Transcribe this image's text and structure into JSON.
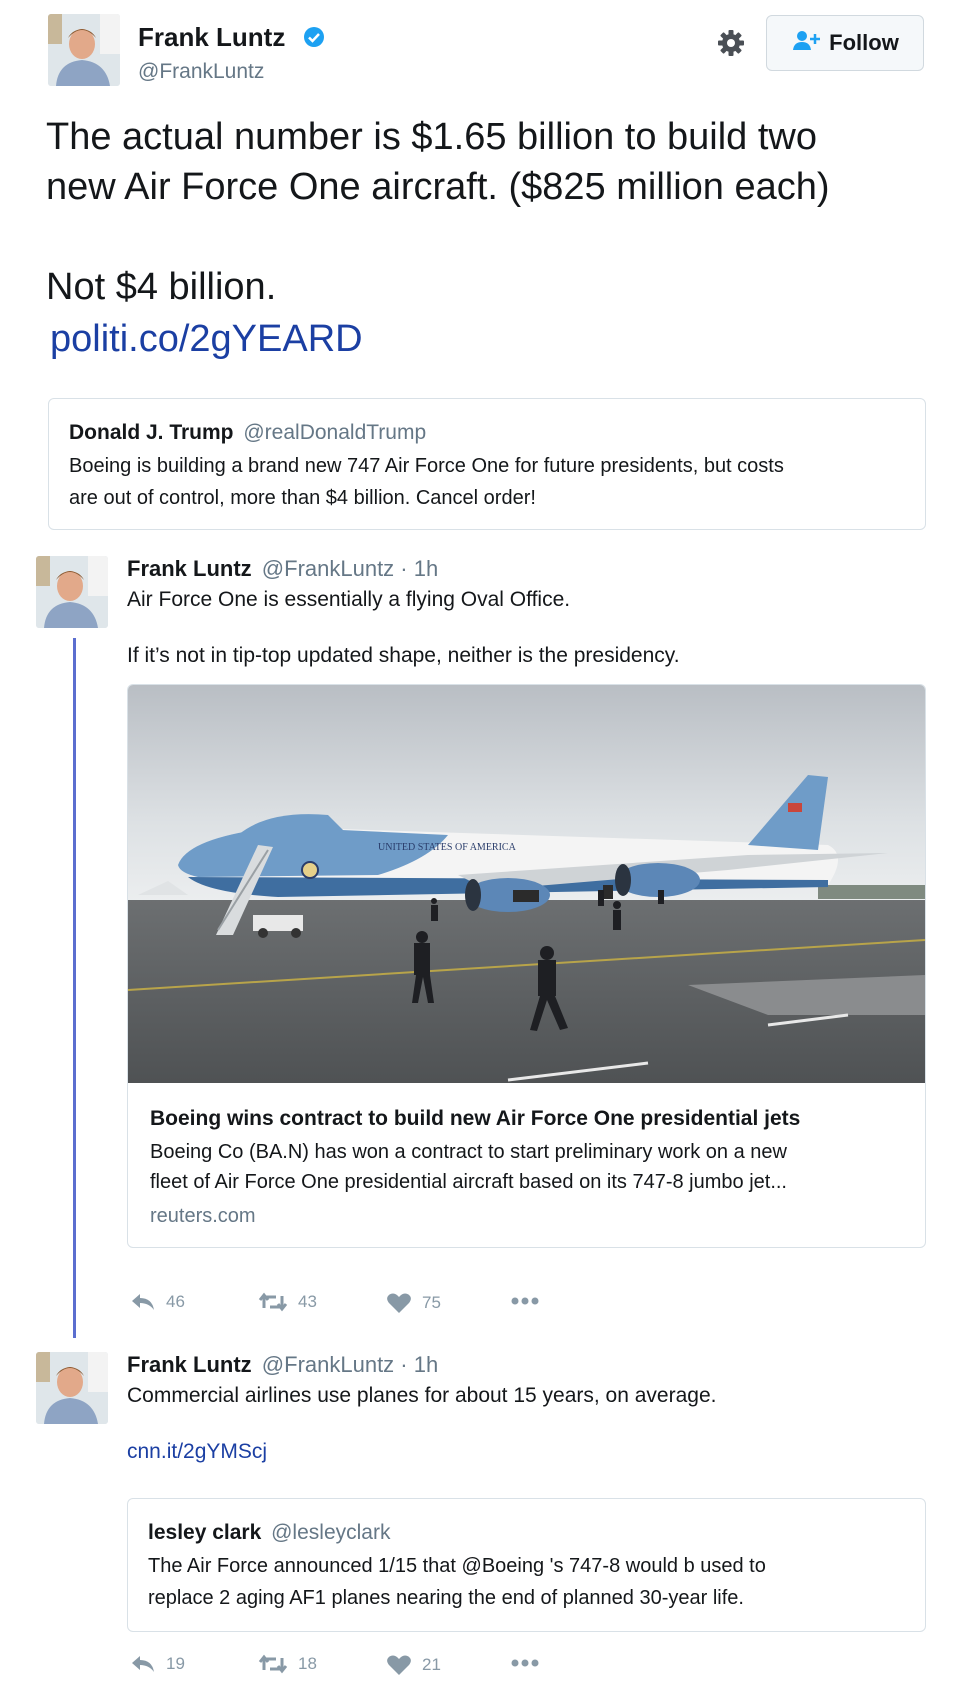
{
  "main_tweet": {
    "name": "Frank Luntz",
    "handle": "@FrankLuntz",
    "follow_label": "Follow",
    "text_line1": "The actual number is $1.65 billion to build two",
    "text_line2": "new Air Force One aircraft. ($825 million each)",
    "text_line3": "Not $4 billion.",
    "link": "politi.co/2gYEARD",
    "quoted": {
      "name": "Donald J. Trump",
      "handle": "@realDonaldTrump",
      "line1": "Boeing is building a brand new 747 Air Force One for future presidents, but costs",
      "line2": "are out of control, more than $4 billion. Cancel order!"
    }
  },
  "reply1": {
    "name": "Frank Luntz",
    "meta": "@FrankLuntz · 1h",
    "text1": "Air Force One is essentially a flying Oval Office.",
    "text2": "If it’s not in tip-top updated shape, neither is the presidency.",
    "card": {
      "image_text": "UNITED STATES OF AMERICA",
      "title": "Boeing wins contract to build new Air Force One presidential jets",
      "desc1": "Boeing Co (BA.N) has won a contract to start preliminary work on a new",
      "desc2": "fleet of Air Force One presidential aircraft based on its 747-8 jumbo jet...",
      "domain": "reuters.com"
    },
    "actions": {
      "replies": "46",
      "retweets": "43",
      "likes": "75"
    }
  },
  "reply2": {
    "name": "Frank Luntz",
    "meta": "@FrankLuntz · 1h",
    "text1": "Commercial airlines use planes for about 15 years, on average.",
    "link": "cnn.it/2gYMScj",
    "quoted": {
      "name": "lesley clark",
      "handle": "@lesleyclark",
      "line1": "The Air Force announced 1/15 that @Boeing 's 747-8 would b used to",
      "line2": "replace 2 aging AF1 planes nearing the end of planned 30-year life."
    },
    "actions": {
      "replies": "19",
      "retweets": "18",
      "likes": "21"
    }
  },
  "icons": [
    "verified-badge-icon",
    "gear-icon",
    "add-user-icon",
    "reply-icon",
    "retweet-icon",
    "heart-icon",
    "more-icon"
  ],
  "colors": {
    "link": "#1b3fa3",
    "verified": "#1da1f2",
    "thread_line": "#5b6ecf",
    "action_grey": "#8899a6"
  }
}
